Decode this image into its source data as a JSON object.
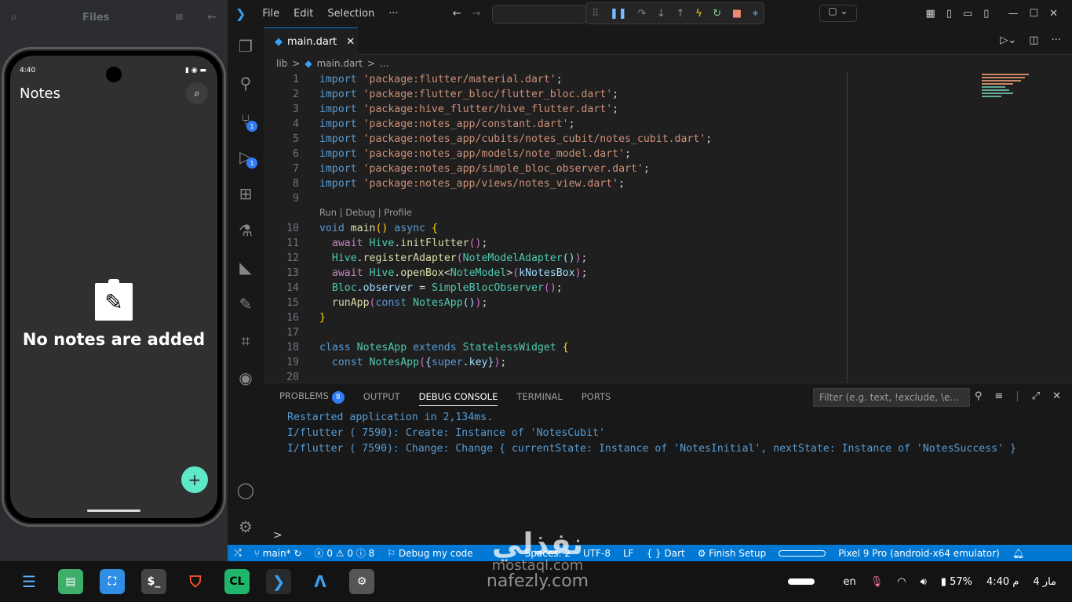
{
  "files_panel": {
    "title": "Files"
  },
  "phone": {
    "time": "4:40",
    "app_title": "Notes",
    "empty_text": "No notes are added",
    "fab": "+"
  },
  "menu": [
    "File",
    "Edit",
    "Selection",
    "···"
  ],
  "editor": {
    "tab": "main.dart",
    "breadcrumb": [
      "lib",
      ">",
      "main.dart",
      ">",
      "..."
    ],
    "codelens": "Run | Debug | Profile",
    "lines": [
      [
        [
          "kw2",
          "import "
        ],
        [
          "str",
          "'package:flutter/material.dart'"
        ],
        [
          "df",
          ";"
        ]
      ],
      [
        [
          "kw2",
          "import "
        ],
        [
          "str",
          "'package:flutter_bloc/flutter_bloc.dart'"
        ],
        [
          "df",
          ";"
        ]
      ],
      [
        [
          "kw2",
          "import "
        ],
        [
          "str",
          "'package:hive_flutter/hive_flutter.dart'"
        ],
        [
          "df",
          ";"
        ]
      ],
      [
        [
          "kw2",
          "import "
        ],
        [
          "str",
          "'package:notes_app/constant.dart'"
        ],
        [
          "df",
          ";"
        ]
      ],
      [
        [
          "kw2",
          "import "
        ],
        [
          "str",
          "'package:notes_app/cubits/notes_cubit/notes_cubit.dart'"
        ],
        [
          "df",
          ";"
        ]
      ],
      [
        [
          "kw2",
          "import "
        ],
        [
          "str",
          "'package:notes_app/models/note_model.dart'"
        ],
        [
          "df",
          ";"
        ]
      ],
      [
        [
          "kw2",
          "import "
        ],
        [
          "str",
          "'package:notes_app/simple_bloc_observer.dart'"
        ],
        [
          "df",
          ";"
        ]
      ],
      [
        [
          "kw2",
          "import "
        ],
        [
          "str",
          "'package:notes_app/views/notes_view.dart'"
        ],
        [
          "df",
          ";"
        ]
      ],
      [],
      [
        [
          "kw2",
          "void "
        ],
        [
          "fn",
          "main"
        ],
        [
          "pn",
          "()"
        ],
        [
          "kw2",
          " async "
        ],
        [
          "pn",
          "{"
        ]
      ],
      [
        [
          "df",
          "  "
        ],
        [
          "kw",
          "await "
        ],
        [
          "cls",
          "Hive"
        ],
        [
          "df",
          "."
        ],
        [
          "fn",
          "initFlutter"
        ],
        [
          "pl",
          "()"
        ],
        [
          "df",
          ";"
        ]
      ],
      [
        [
          "df",
          "  "
        ],
        [
          "cls",
          "Hive"
        ],
        [
          "df",
          "."
        ],
        [
          "fn",
          "registerAdapter"
        ],
        [
          "pl",
          "("
        ],
        [
          "cls",
          "NoteModelAdapter"
        ],
        [
          "var",
          "()"
        ],
        [
          "pl",
          ")"
        ],
        [
          "df",
          ";"
        ]
      ],
      [
        [
          "df",
          "  "
        ],
        [
          "kw",
          "await "
        ],
        [
          "cls",
          "Hive"
        ],
        [
          "df",
          "."
        ],
        [
          "fn",
          "openBox"
        ],
        [
          "df",
          "<"
        ],
        [
          "cls",
          "NoteModel"
        ],
        [
          "df",
          ">"
        ],
        [
          "pl",
          "("
        ],
        [
          "var",
          "kNotesBox"
        ],
        [
          "pl",
          ")"
        ],
        [
          "df",
          ";"
        ]
      ],
      [
        [
          "df",
          "  "
        ],
        [
          "cls",
          "Bloc"
        ],
        [
          "df",
          "."
        ],
        [
          "var",
          "observer"
        ],
        [
          "df",
          " = "
        ],
        [
          "cls",
          "SimpleBlocObserver"
        ],
        [
          "pl",
          "()"
        ],
        [
          "df",
          ";"
        ]
      ],
      [
        [
          "df",
          "  "
        ],
        [
          "fn",
          "runApp"
        ],
        [
          "pl",
          "("
        ],
        [
          "kw2",
          "const "
        ],
        [
          "cls",
          "NotesApp"
        ],
        [
          "var",
          "()"
        ],
        [
          "pl",
          ")"
        ],
        [
          "df",
          ";"
        ]
      ],
      [
        [
          "pn",
          "}"
        ]
      ],
      [],
      [
        [
          "kw2",
          "class "
        ],
        [
          "cls",
          "NotesApp"
        ],
        [
          "kw2",
          " extends "
        ],
        [
          "cls",
          "StatelessWidget"
        ],
        [
          "pn",
          " {"
        ]
      ],
      [
        [
          "df",
          "  "
        ],
        [
          "kw2",
          "const "
        ],
        [
          "cls",
          "NotesApp"
        ],
        [
          "pl",
          "("
        ],
        [
          "var",
          "{"
        ],
        [
          "kw2",
          "super"
        ],
        [
          "df",
          "."
        ],
        [
          "var",
          "key"
        ],
        [
          "var",
          "}"
        ],
        [
          "pl",
          ")"
        ],
        [
          "df",
          ";"
        ]
      ],
      []
    ]
  },
  "panel": {
    "tabs": [
      "PROBLEMS",
      "OUTPUT",
      "DEBUG CONSOLE",
      "TERMINAL",
      "PORTS"
    ],
    "problems_count": "8",
    "filter_placeholder": "Filter (e.g. text, !exclude, \\e...",
    "console": [
      "Restarted application in 2,134ms.",
      "I/flutter ( 7590): Create: Instance of 'NotesCubit'",
      "I/flutter ( 7590): Change: Change { currentState: Instance of 'NotesInitial', nextState: Instance of 'NotesSuccess' }"
    ],
    "prompt": ">"
  },
  "statusbar": {
    "branch": "main*",
    "errors": "0",
    "warnings": "0",
    "info": "8",
    "debug": "Debug my code",
    "spaces": "Spaces: 2",
    "encoding": "UTF-8",
    "eol": "LF",
    "lang": "{ } Dart",
    "setup": "Finish Setup",
    "device": "Pixel 9 Pro (android-x64 emulator)"
  },
  "taskbar": {
    "lang": "en",
    "battery": "57%",
    "time": "4:40 م",
    "date": "4 مار"
  },
  "watermark": {
    "arabic": "نفذلي",
    "url1": "mostaql.com",
    "url2": "nafezly.com"
  },
  "colors": {
    "accent": "#0078d4",
    "fab": "#5de8c8",
    "badge": "#2f7df6"
  }
}
